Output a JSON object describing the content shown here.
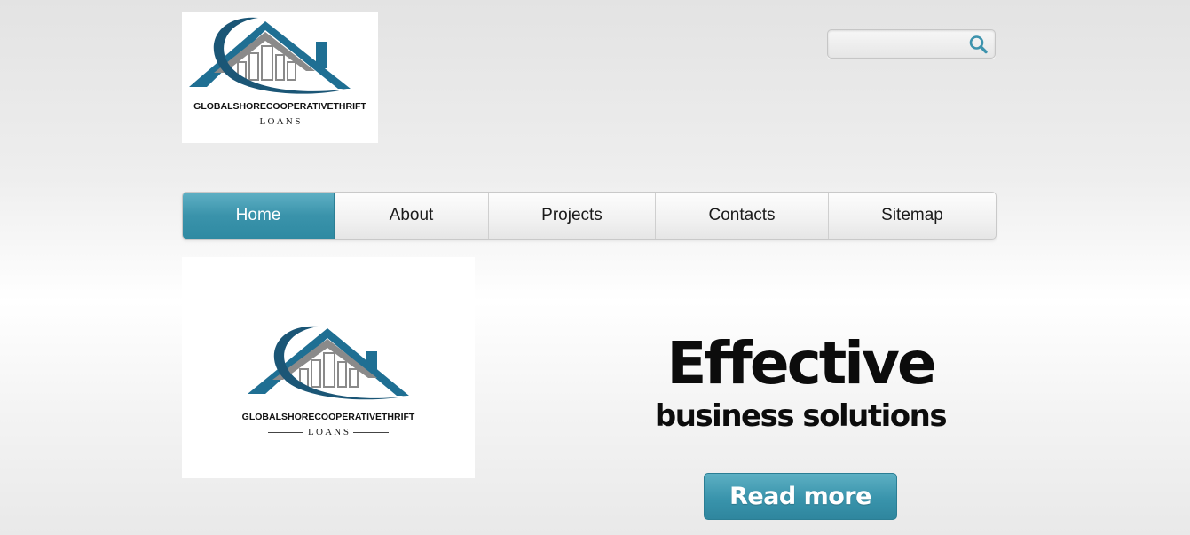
{
  "brand": {
    "name": "GLOBALSHORECOOPERATIVETHRIFT",
    "tagline": "L O A N S",
    "colors": {
      "blue": "#1f6f93",
      "gray": "#8a8a8a",
      "dark_blue": "#1b5676"
    }
  },
  "search": {
    "value": "",
    "placeholder": "",
    "icon": "search-icon"
  },
  "nav": {
    "items": [
      {
        "label": "Home",
        "active": true
      },
      {
        "label": "About",
        "active": false
      },
      {
        "label": "Projects",
        "active": false
      },
      {
        "label": "Contacts",
        "active": false
      },
      {
        "label": "Sitemap",
        "active": false
      }
    ],
    "active_color": "#3a93ab"
  },
  "banner": {
    "headline": "Effective",
    "subhead": "business solutions",
    "button_label": "Read more",
    "button_color": "#3994ac"
  }
}
